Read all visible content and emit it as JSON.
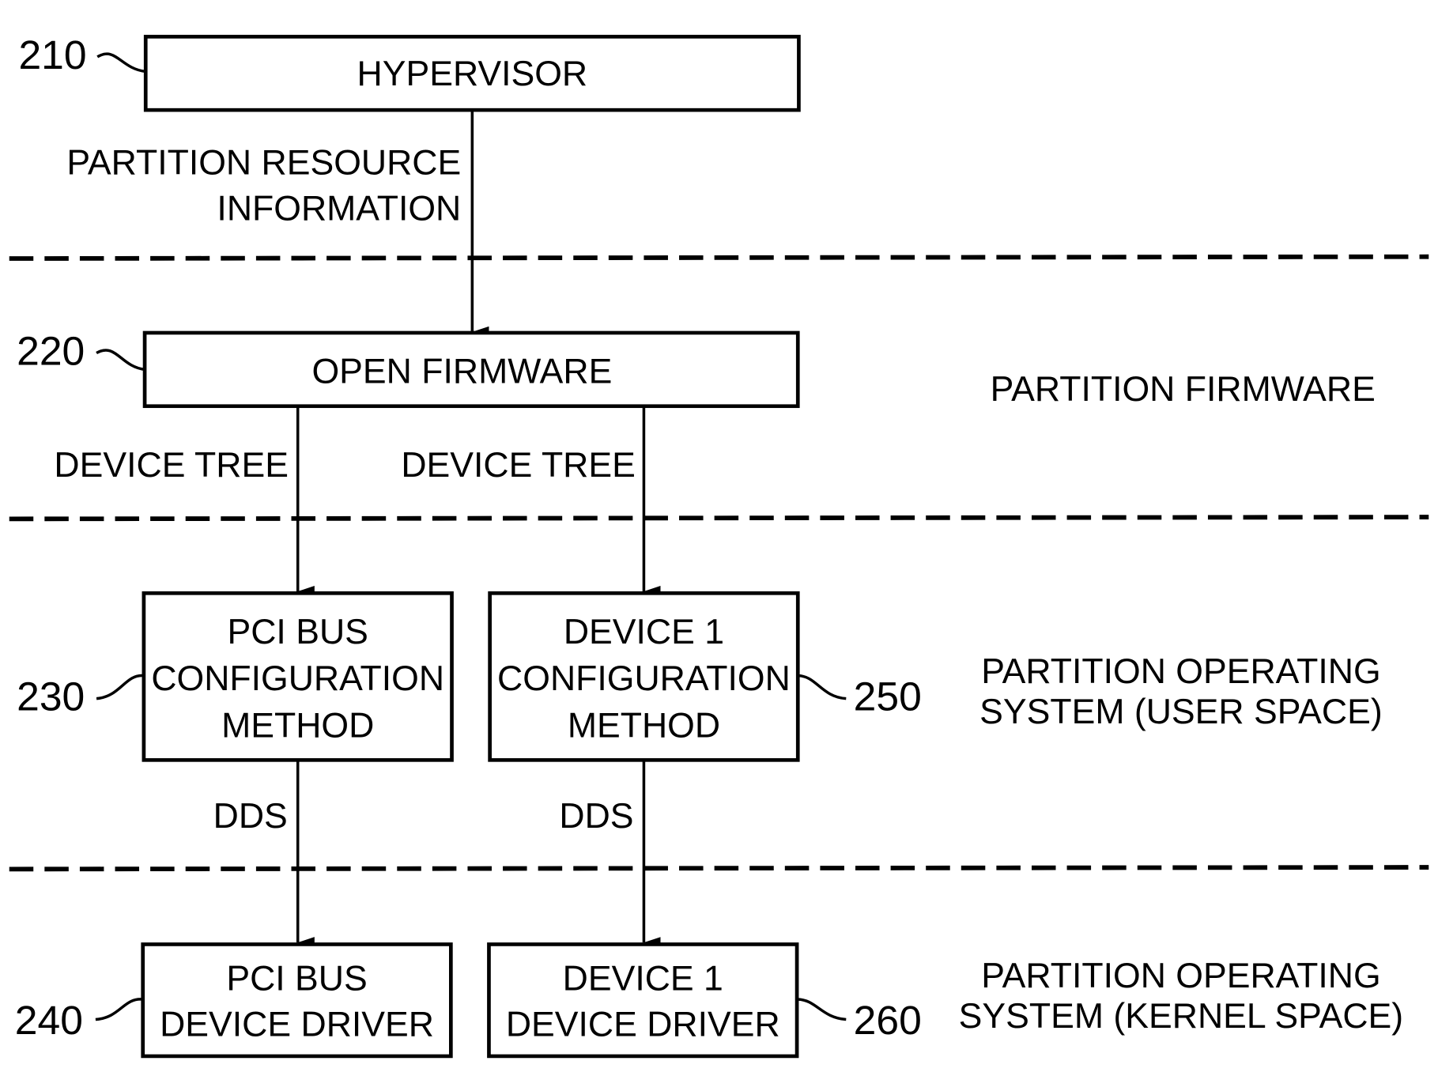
{
  "diagram": {
    "blocks": {
      "hypervisor": {
        "ref": "210",
        "lines": [
          "HYPERVISOR"
        ]
      },
      "open_firmware": {
        "ref": "220",
        "lines": [
          "OPEN FIRMWARE"
        ]
      },
      "pci_config": {
        "ref": "230",
        "lines": [
          "PCI BUS",
          "CONFIGURATION",
          "METHOD"
        ]
      },
      "pci_driver": {
        "ref": "240",
        "lines": [
          "PCI BUS",
          "DEVICE DRIVER"
        ]
      },
      "dev1_config": {
        "ref": "250",
        "lines": [
          "DEVICE 1",
          "CONFIGURATION",
          "METHOD"
        ]
      },
      "dev1_driver": {
        "ref": "260",
        "lines": [
          "DEVICE 1",
          "DEVICE DRIVER"
        ]
      }
    },
    "edges": {
      "hyp_to_of": [
        "PARTITION RESOURCE",
        "INFORMATION"
      ],
      "of_to_pci": "DEVICE TREE",
      "of_to_dev1": "DEVICE TREE",
      "pci_dds": "DDS",
      "dev1_dds": "DDS"
    },
    "zones": {
      "firmware": "PARTITION FIRMWARE",
      "user_space": [
        "PARTITION OPERATING",
        "SYSTEM (USER SPACE)"
      ],
      "kernel_space": [
        "PARTITION OPERATING",
        "SYSTEM (KERNEL SPACE)"
      ]
    }
  }
}
